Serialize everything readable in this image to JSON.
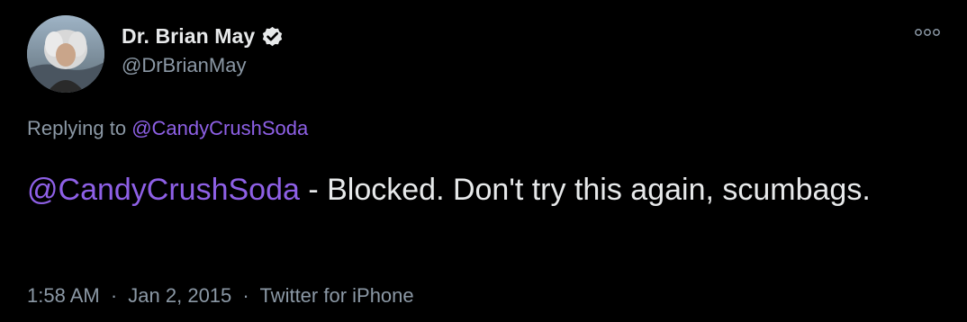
{
  "author": {
    "display_name": "Dr. Brian May",
    "handle": "@DrBrianMay",
    "verified": true,
    "avatar_icon": "profile-photo"
  },
  "more_icon": "more-options-icon",
  "reply": {
    "prefix": "Replying to",
    "mention": "@CandyCrushSoda"
  },
  "tweet": {
    "mention": "@CandyCrushSoda",
    "text": " - Blocked. Don't try this again, scumbags."
  },
  "meta": {
    "time": "1:58 AM",
    "separator1": "·",
    "date": "Jan 2, 2015",
    "separator2": "·",
    "source": "Twitter for iPhone"
  },
  "colors": {
    "background": "#000000",
    "primary_text": "#e7e9ea",
    "secondary_text": "#8b98a5",
    "mention": "#8e60e6"
  }
}
